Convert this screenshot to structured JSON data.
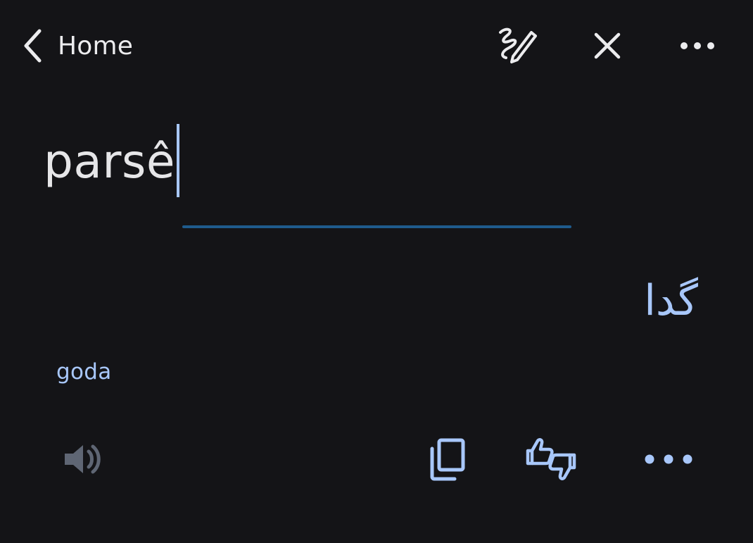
{
  "header": {
    "back_label": "Home",
    "back_icon": "chevron-left-icon",
    "handwriting_icon": "handwriting-icon",
    "close_icon": "close-icon",
    "more_icon": "more-horizontal-icon"
  },
  "input": {
    "text": "parsê"
  },
  "output": {
    "translation": "گدا",
    "transliteration": "goda"
  },
  "actions": {
    "listen_icon": "speaker-icon",
    "copy_icon": "copy-icon",
    "feedback_icon": "thumbs-up-down-icon",
    "more_icon": "more-horizontal-icon"
  },
  "colors": {
    "background": "#141417",
    "text": "#e6e6e8",
    "accent": "#a8c7fa",
    "underline": "#1f5b8c",
    "disabled_icon": "#5f6674"
  }
}
